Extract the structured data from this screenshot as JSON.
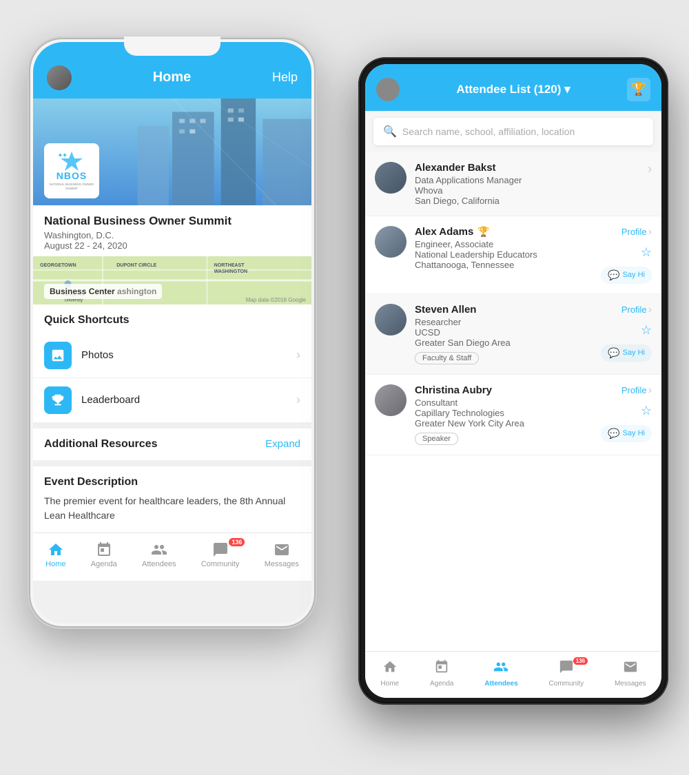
{
  "left_phone": {
    "header": {
      "title": "Home",
      "help_label": "Help"
    },
    "event": {
      "name": "National Business Owner Summit",
      "location": "Washington, D.C.",
      "dates": "August 22 - 24, 2020",
      "logo_text": "NBOS",
      "logo_subtext": "NATIONAL BUSINESS OWNER SUMMIT"
    },
    "map": {
      "label": "Business Center",
      "data_label": "Map data ©2018 Google",
      "areas": [
        "GEORGETOWN",
        "DUPONT CIRCLE",
        "NORTHEAST WASHINGTON"
      ]
    },
    "shortcuts": {
      "title": "Quick Shortcuts",
      "items": [
        {
          "label": "Photos",
          "icon": "photo-icon"
        },
        {
          "label": "Leaderboard",
          "icon": "leaderboard-icon"
        }
      ]
    },
    "additional_resources": {
      "title": "Additional Resources",
      "expand_label": "Expand"
    },
    "event_description": {
      "title": "Event Description",
      "text": "The premier event for healthcare leaders, the 8th Annual Lean Healthcare"
    },
    "bottom_nav": {
      "items": [
        {
          "label": "Home",
          "icon": "home-icon",
          "active": true
        },
        {
          "label": "Agenda",
          "icon": "agenda-icon",
          "active": false
        },
        {
          "label": "Attendees",
          "icon": "attendees-icon",
          "active": false
        },
        {
          "label": "Community",
          "icon": "community-icon",
          "active": false,
          "badge": "136"
        },
        {
          "label": "Messages",
          "icon": "messages-icon",
          "active": false
        }
      ]
    }
  },
  "right_phone": {
    "header": {
      "title": "Attendee List (120) ▾",
      "trophy_icon": "trophy-icon"
    },
    "search": {
      "placeholder": "Search name, school, affiliation, location"
    },
    "attendees": [
      {
        "name": "Alexander Bakst",
        "role": "Data Applications Manager",
        "org": "Whova",
        "location": "San Diego, California",
        "has_profile": false,
        "has_sayhi": false,
        "tags": [],
        "bg": "gray"
      },
      {
        "name": "Alex Adams",
        "trophy": "🏆",
        "role": "Engineer, Associate",
        "org": "National Leadership Educators",
        "location": "Chattanooga, Tennessee",
        "has_profile": true,
        "has_sayhi": true,
        "tags": []
      },
      {
        "name": "Steven Allen",
        "role": "Researcher",
        "org": "UCSD",
        "location": "Greater San Diego Area",
        "has_profile": true,
        "has_sayhi": true,
        "tags": [
          "Faculty & Staff"
        ]
      },
      {
        "name": "Christina Aubry",
        "role": "Consultant",
        "org": "Capillary Technologies",
        "location": "Greater New York City Area",
        "has_profile": true,
        "has_sayhi": true,
        "tags": [
          "Speaker"
        ]
      }
    ],
    "bottom_nav": {
      "items": [
        {
          "label": "Home",
          "icon": "home-icon",
          "active": false
        },
        {
          "label": "Agenda",
          "icon": "agenda-icon",
          "active": false
        },
        {
          "label": "Attendees",
          "icon": "attendees-icon",
          "active": true
        },
        {
          "label": "Community",
          "icon": "community-icon",
          "active": false,
          "badge": "136"
        },
        {
          "label": "Messages",
          "icon": "messages-icon",
          "active": false
        }
      ]
    },
    "labels": {
      "profile": "Profile",
      "say_hi": "Say Hi",
      "faculty_staff": "Faculty & Staff",
      "speaker": "Speaker"
    }
  }
}
